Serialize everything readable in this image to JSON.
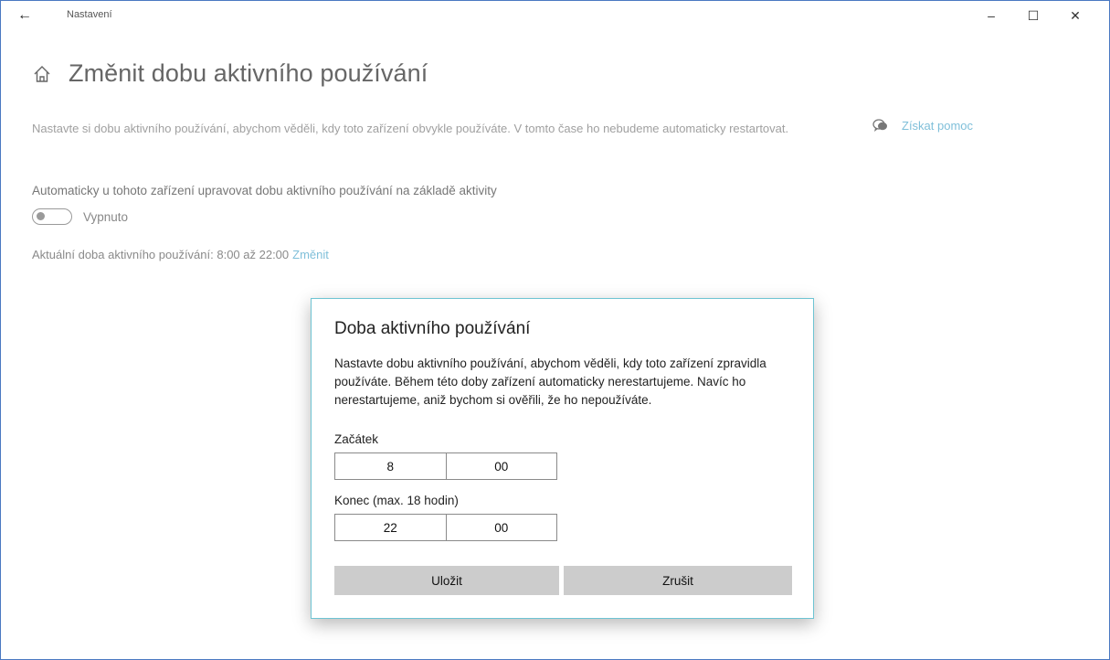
{
  "window": {
    "title": "Nastavení",
    "back_icon": "←",
    "controls": {
      "minimize": "–",
      "maximize": "☐",
      "close": "✕"
    }
  },
  "page": {
    "title": "Změnit dobu aktivního používání",
    "description": "Nastavte si dobu aktivního používání, abychom věděli, kdy toto zařízení obvykle používáte. V tomto čase ho nebudeme automaticky restartovat.",
    "help_link": "Získat pomoc",
    "auto_label": "Automaticky u tohoto zařízení upravovat dobu aktivního používání na základě aktivity",
    "toggle_state": "Vypnuto",
    "current_text": "Aktuální doba aktivního používání: 8:00 až 22:00",
    "change_link": "Změnit"
  },
  "dialog": {
    "title": "Doba aktivního používání",
    "text": "Nastavte dobu aktivního používání, abychom věděli, kdy toto zařízení zpravidla používáte. Během této doby zařízení automaticky nerestartujeme. Navíc ho nerestartujeme, aniž bychom si ověřili, že ho nepoužíváte.",
    "start_label": "Začátek",
    "start_hour": "8",
    "start_minute": "00",
    "end_label": "Konec (max. 18 hodin)",
    "end_hour": "22",
    "end_minute": "00",
    "save_label": "Uložit",
    "cancel_label": "Zrušit"
  },
  "colors": {
    "accent_link": "#7fbfd9",
    "dialog_border": "#6ec4d3",
    "window_border": "#4a78c2",
    "button_bg": "#cccccc"
  }
}
